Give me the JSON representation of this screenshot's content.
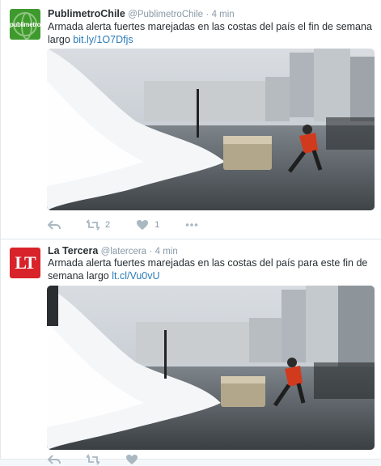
{
  "tweets": [
    {
      "name": "PublimetroChile",
      "handle": "@PublimetroChile",
      "separator": "·",
      "time": "4 min",
      "avatar_text": "publimetro",
      "text": "Armada alerta fuertes marejadas en las costas del país el fin de semana largo ",
      "link": "bit.ly/1O7Dfjs",
      "retweets": "2",
      "likes": "1",
      "media_alt": "Waves crashing over a seaside promenade while a man runs past"
    },
    {
      "name": "La Tercera",
      "handle": "@latercera",
      "separator": "·",
      "time": "4 min",
      "avatar_text": "LT",
      "text": "Armada alerta fuertes marejadas en las costas del país para este fin de semana largo ",
      "link": "lt.cl/Vu0vU",
      "retweets": "",
      "likes": "",
      "media_alt": "Waves crashing over a seaside promenade while a man runs past"
    }
  ],
  "icons": {
    "reply": "reply-icon",
    "retweet": "retweet-icon",
    "like": "heart-icon",
    "more": "more-icon"
  },
  "colors": {
    "link": "#2b7bb9",
    "name": "#292f33",
    "meta": "#8899a6",
    "action": "#aab8c2",
    "publimetro_green": "#3f9a2e",
    "latercera_red": "#d8232a"
  }
}
